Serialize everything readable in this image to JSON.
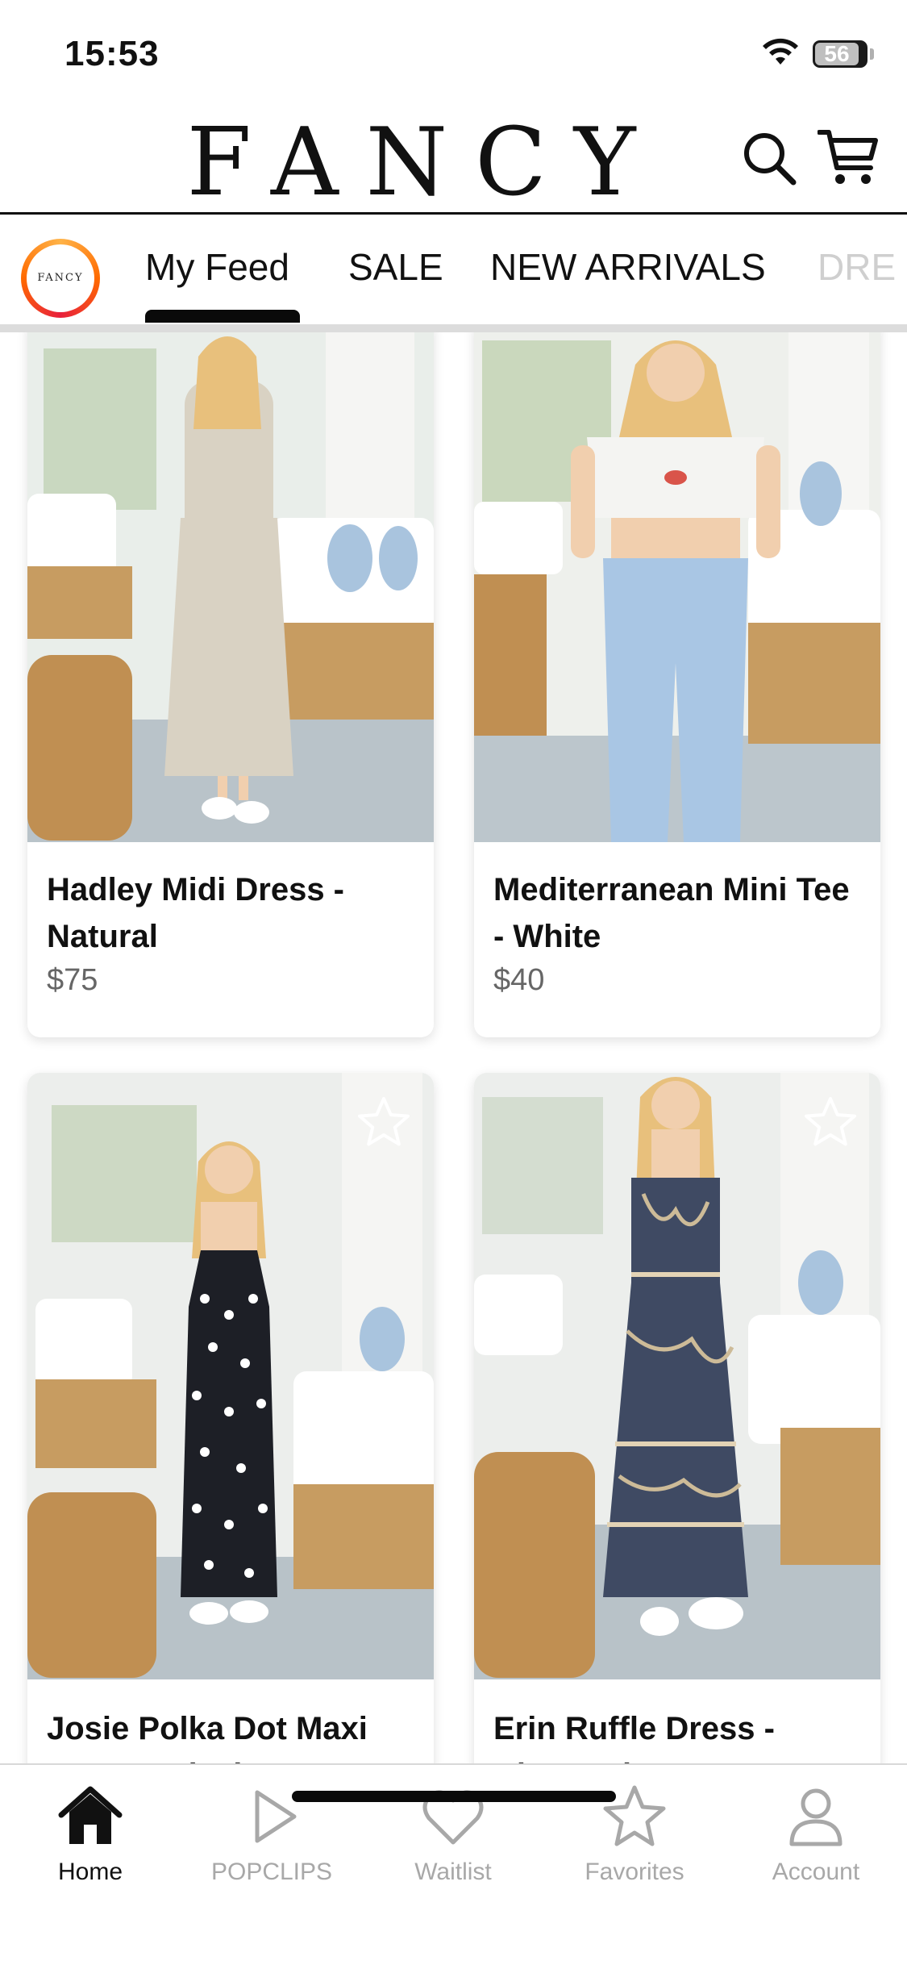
{
  "status_bar": {
    "time": "15:53",
    "battery_level": "56"
  },
  "header": {
    "brand": "FANCY"
  },
  "tabs": {
    "logo_text": "FANCY",
    "items": [
      {
        "label": "My Feed",
        "active": true
      },
      {
        "label": "SALE",
        "active": false
      },
      {
        "label": "NEW ARRIVALS",
        "active": false
      },
      {
        "label": "DRE",
        "active": false
      }
    ]
  },
  "products": [
    {
      "name": "Hadley Midi Dress - Natural",
      "price": "$75",
      "dress_color": "#d9d2c3",
      "favorite_visible": false
    },
    {
      "name": "Mediterranean Mini Tee - White",
      "price": "$40",
      "dress_color": "#f4f4f2",
      "favorite_visible": false
    },
    {
      "name": "Josie Polka Dot Maxi Dress - Black",
      "price": "",
      "dress_color": "#1d1f26",
      "favorite_visible": true
    },
    {
      "name": "Erin Ruffle Dress - Charcoal",
      "price": "",
      "dress_color": "#3f4a63",
      "favorite_visible": true
    }
  ],
  "bottom_nav": [
    {
      "label": "Home",
      "icon": "home-icon",
      "active": true
    },
    {
      "label": "POPCLIPS",
      "icon": "play-icon",
      "active": false
    },
    {
      "label": "Waitlist",
      "icon": "heart-icon",
      "active": false
    },
    {
      "label": "Favorites",
      "icon": "star-icon",
      "active": false
    },
    {
      "label": "Account",
      "icon": "account-icon",
      "active": false
    }
  ],
  "colors": {
    "accent": "#111111",
    "inactive": "#a8a8a8",
    "logo_ring": "#ff6a00"
  }
}
